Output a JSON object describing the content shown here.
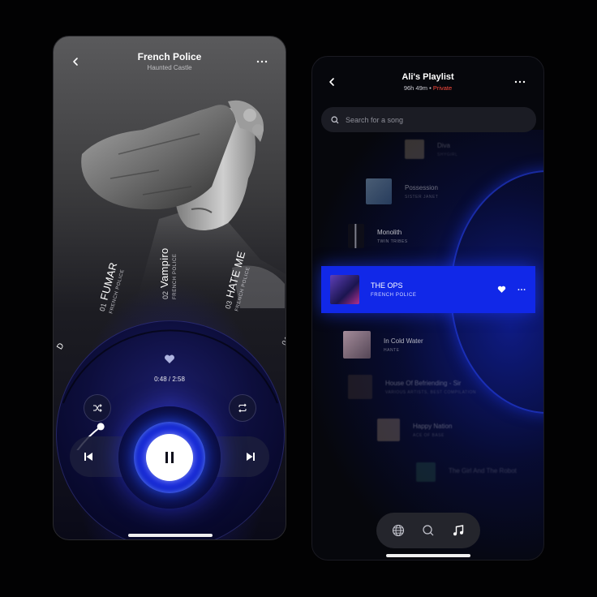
{
  "player": {
    "title": "French Police",
    "artist": "Haunted Castle",
    "time": "0:48 / 2:58",
    "progress_fraction": 0.27,
    "tracks": [
      {
        "num": "01",
        "name": "FUMAR",
        "artist": "FRENCH POLICE"
      },
      {
        "num": "02",
        "name": "Vampiro",
        "artist": "FRENCH POLICE"
      },
      {
        "num": "03",
        "name": "HATE ME",
        "artist": "FRENCH POLICE"
      },
      {
        "num": "04",
        "name": ""
      }
    ]
  },
  "playlist": {
    "title": "Ali's Playlist",
    "duration": "96h 49m",
    "separator": "•",
    "visibility": "Private",
    "search_placeholder": "Search for a song",
    "songs": [
      {
        "title": "Diva",
        "artist": "SHYGIRL",
        "thumb": "#c8b48a",
        "faded": true
      },
      {
        "title": "Possession",
        "artist": "SISTER JANET",
        "thumb": "#7fa7c8",
        "faded": true
      },
      {
        "title": "Monolith",
        "artist": "TWIN TRIBES",
        "thumb": "#6b6b78",
        "faded": false
      },
      {
        "title": "THE OPS",
        "artist": "FRENCH POLICE",
        "thumb": "#3a2b8f",
        "active": true
      },
      {
        "title": "In Cold Water",
        "artist": "HANTE",
        "thumb": "#b49aa6",
        "faded": false
      },
      {
        "title": "House Of Befriending - Sir",
        "artist": "VARIOUS ARTISTS, BEST COMPILATION",
        "thumb": "#4a3c36",
        "faded": true
      },
      {
        "title": "Happy Nation",
        "artist": "ACE OF BASE",
        "thumb": "#a08870",
        "faded": true
      },
      {
        "title": "The Girl And The Robot",
        "artist": "",
        "thumb": "#3f8a6a",
        "faded": true
      }
    ]
  },
  "colors": {
    "accent": "#1128e8",
    "private": "#ff4a3d"
  },
  "icons": [
    "back-icon",
    "more-icon",
    "heart-icon",
    "shuffle-icon",
    "repeat-icon",
    "previous-icon",
    "pause-icon",
    "next-icon",
    "search-icon",
    "globe-icon",
    "music-note-icon"
  ]
}
